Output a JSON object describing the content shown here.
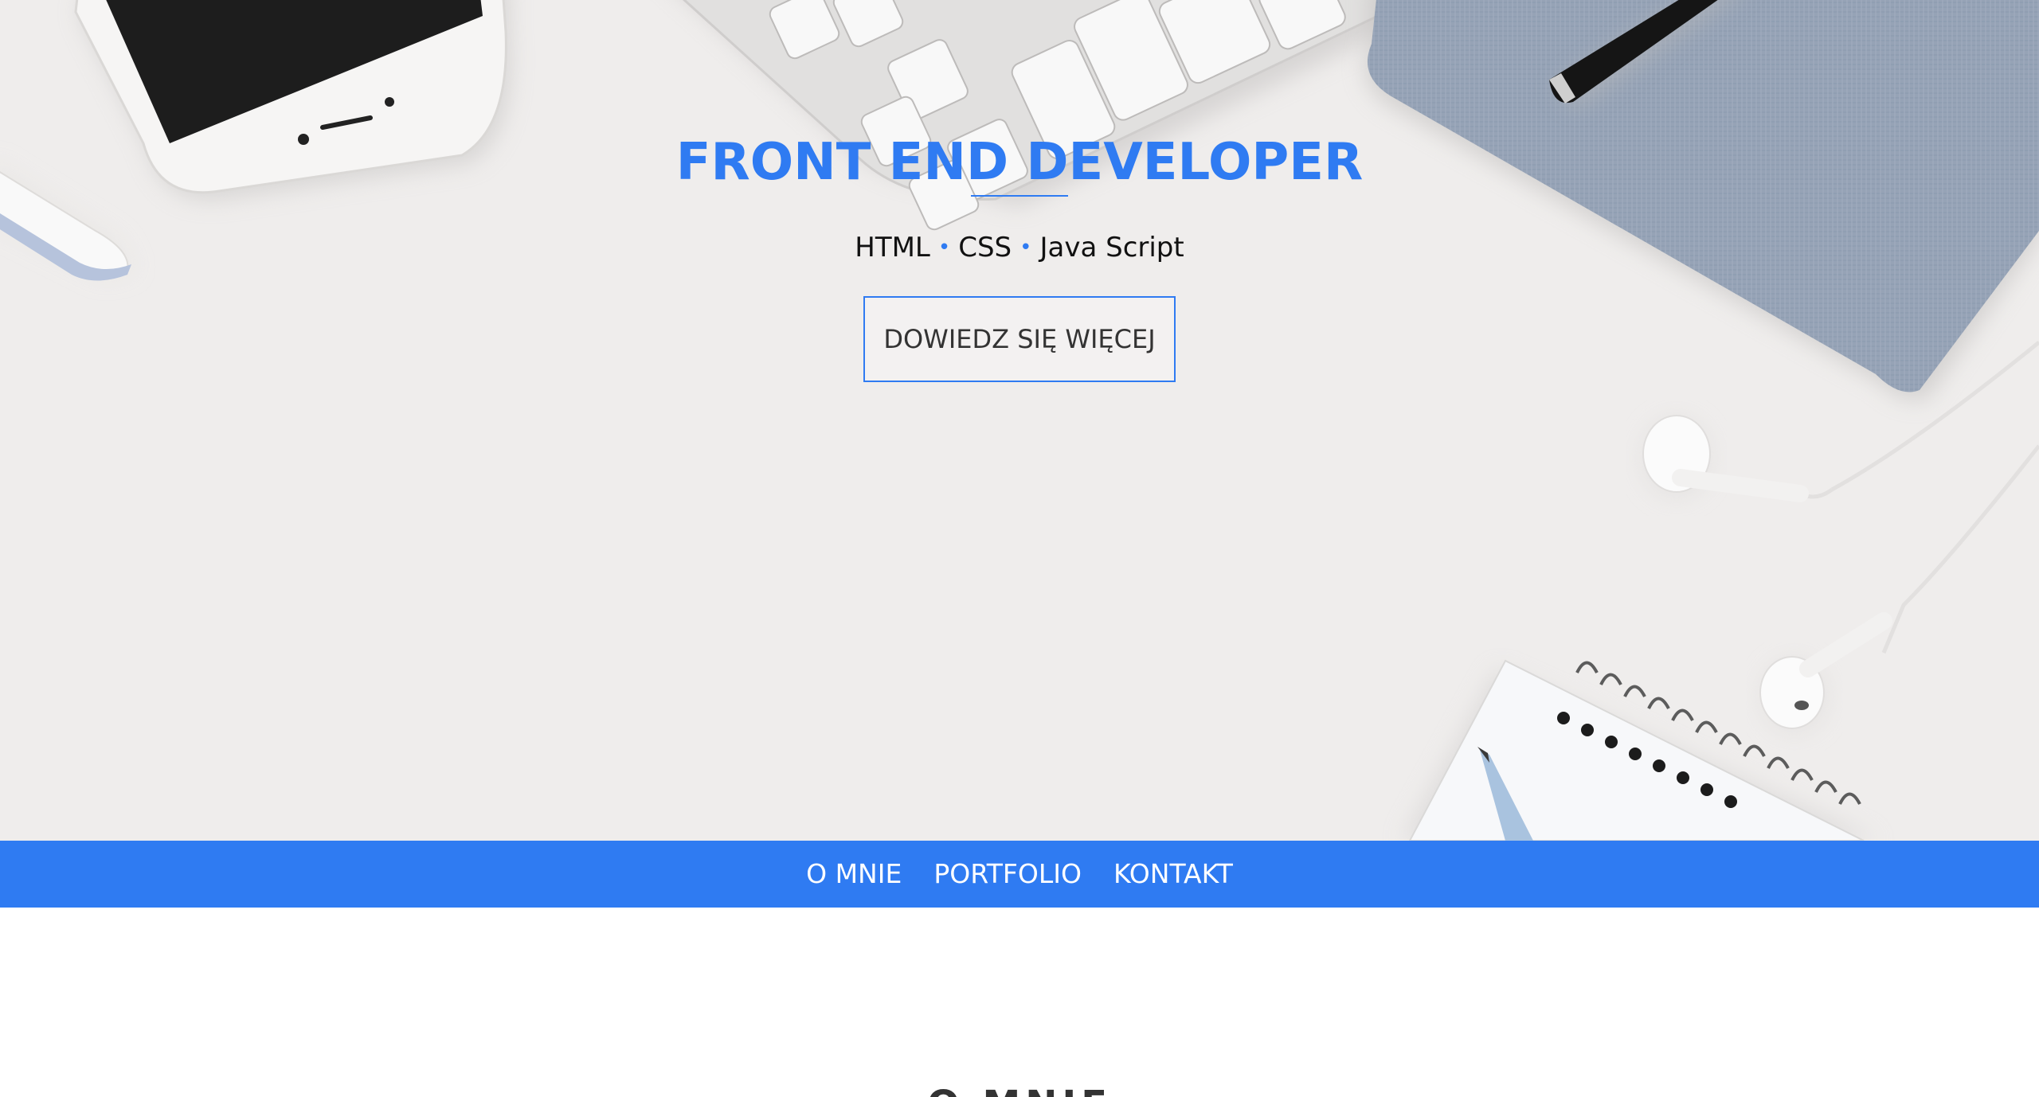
{
  "hero": {
    "title": "FRONT END DEVELOPER",
    "skills": [
      "HTML",
      "CSS",
      "Java Script"
    ],
    "separator": "•",
    "cta_label": "DOWIEDZ SIĘ WIĘCEJ"
  },
  "nav": {
    "items": [
      {
        "label": "O MNIE"
      },
      {
        "label": "PORTFOLIO"
      },
      {
        "label": "KONTAKT"
      }
    ]
  },
  "about": {
    "heading": "O MNIE"
  },
  "colors": {
    "accent": "#2f7bf2",
    "hero_background": "#efedec",
    "text_dark": "#111111"
  },
  "icons": [
    "smartphone",
    "keyboard",
    "pen",
    "notebook",
    "earphones",
    "spiral-notepad",
    "pencil"
  ]
}
